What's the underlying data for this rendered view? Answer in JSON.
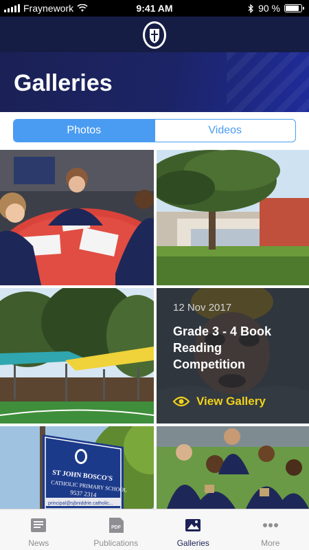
{
  "status_bar": {
    "carrier": "Fraynework",
    "time": "9:41 AM",
    "battery": "90 %"
  },
  "header": {
    "title": "Galleries"
  },
  "segmented": {
    "photos": "Photos",
    "videos": "Videos",
    "selected": "Photos"
  },
  "galleries": [
    {
      "date": "12 Nov 2017",
      "title": "Grade 3 - 4 Book Reading Competition",
      "link": "View Gallery"
    }
  ],
  "sign": {
    "line1": "ST JOHN BOSCO'S",
    "line2": "CATHOLIC PRIMARY SCHOOL",
    "line3": "9537 2314",
    "line4": "principal@sjbniddrie.catholic..."
  },
  "tabbar": {
    "items": [
      {
        "label": "News"
      },
      {
        "label": "Publications",
        "icon_text": "PDF"
      },
      {
        "label": "Galleries"
      },
      {
        "label": "More"
      }
    ],
    "active": "Galleries"
  },
  "colors": {
    "header_bg": "#161d44",
    "accent": "#4a9cf2",
    "link": "#f2d21a",
    "tab_active": "#1b2155"
  }
}
